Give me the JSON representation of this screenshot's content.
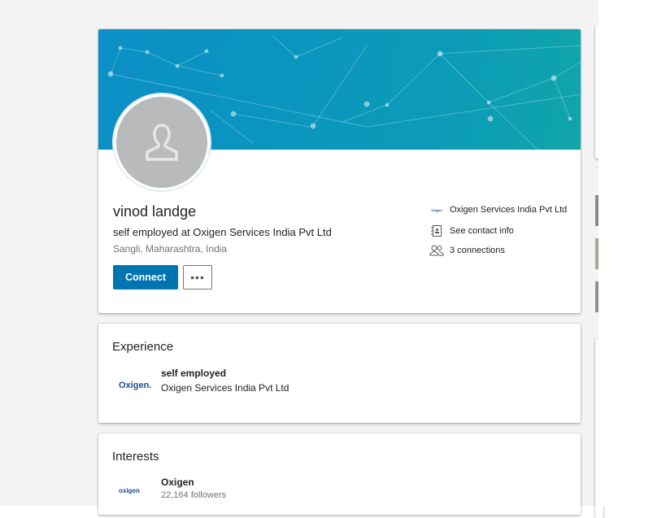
{
  "profile": {
    "name": "vinod landge",
    "headline": "self employed at Oxigen Services India Pvt Ltd",
    "location": "Sangli, Maharashtra, India",
    "connect_label": "Connect",
    "more_label": "•••",
    "side": {
      "company": "Oxigen Services India Pvt Ltd",
      "contact": "See contact info",
      "connections": "3 connections"
    }
  },
  "experience": {
    "title": "Experience",
    "items": [
      {
        "role": "self employed",
        "company": "Oxigen Services India Pvt Ltd",
        "logo": "Oxigen."
      }
    ]
  },
  "interests": {
    "title": "Interests",
    "items": [
      {
        "name": "Oxigen",
        "followers": "22,164 followers",
        "logo": "oxigen"
      }
    ]
  },
  "colors": {
    "accent": "#0073b1",
    "background": "#f3f3f3"
  }
}
